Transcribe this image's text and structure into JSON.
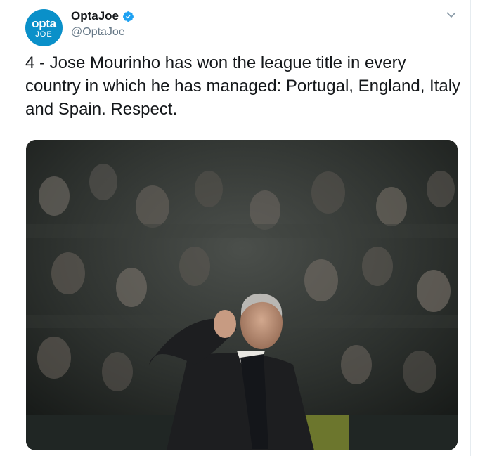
{
  "tweet": {
    "avatar": {
      "line1": "opta",
      "line2": "JOE"
    },
    "display_name": "OptaJoe",
    "handle": "@OptaJoe",
    "text": "4 - Jose Mourinho has won the league title in every country in which he has managed: Portugal, England, Italy and Spain. Respect."
  },
  "icons": {
    "verified": "verified-badge-icon",
    "menu": "chevron-down-icon"
  },
  "colors": {
    "brand": "#0a90c9",
    "verified": "#1da1f2",
    "handle": "#657786",
    "text": "#14171a"
  }
}
